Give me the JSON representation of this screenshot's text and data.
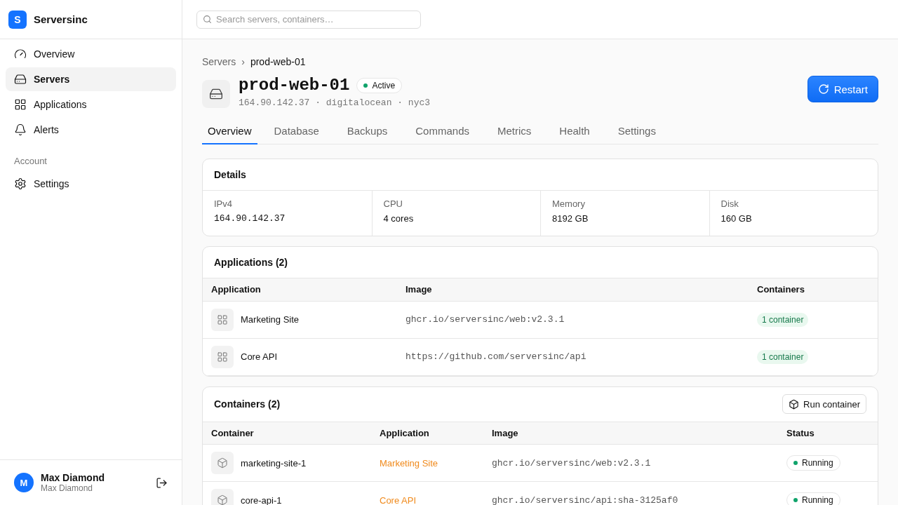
{
  "sidebar": {
    "logo_letter": "S",
    "brand": "Serversinc",
    "items": [
      {
        "label": "Overview",
        "selected": false
      },
      {
        "label": "Servers",
        "selected": true
      },
      {
        "label": "Applications",
        "selected": false
      },
      {
        "label": "Alerts",
        "selected": false
      }
    ],
    "section_label": "Account",
    "account_items": [
      {
        "label": "Settings",
        "selected": false
      }
    ],
    "user": {
      "initial": "M",
      "name": "Max Diamond",
      "subtitle": "Max Diamond"
    }
  },
  "search": {
    "placeholder": "Search servers, containers…"
  },
  "breadcrumb": {
    "parent": "Servers",
    "separator": "›",
    "current": "prod-web-01"
  },
  "server": {
    "name": "prod-web-01",
    "status": "Active",
    "meta": "164.90.142.37 · digitalocean · nyc3",
    "action": "Restart"
  },
  "tabs": [
    {
      "label": "Overview",
      "selected": true
    },
    {
      "label": "Database",
      "selected": false
    },
    {
      "label": "Backups",
      "selected": false
    },
    {
      "label": "Commands",
      "selected": false
    },
    {
      "label": "Metrics",
      "selected": false
    },
    {
      "label": "Health",
      "selected": false
    },
    {
      "label": "Settings",
      "selected": false
    }
  ],
  "details": {
    "title": "Details",
    "fields": [
      {
        "label": "IPv4",
        "value": "164.90.142.37",
        "kind": "code"
      },
      {
        "label": "CPU",
        "value": "4 cores",
        "kind": "text"
      },
      {
        "label": "Memory",
        "value": "8192 GB",
        "kind": "text"
      },
      {
        "label": "Disk",
        "value": "160 GB",
        "kind": "text"
      }
    ]
  },
  "applications": {
    "title": "Applications (2)",
    "columns": [
      "Application",
      "Image",
      "Containers"
    ],
    "rows": [
      {
        "name": "Marketing Site",
        "image": "ghcr.io/serversinc/web:v2.3.1",
        "containers": "1 container"
      },
      {
        "name": "Core API",
        "image": "https://github.com/serversinc/api",
        "containers": "1 container"
      }
    ]
  },
  "containers": {
    "title": "Containers (2)",
    "action": "Run container",
    "columns": [
      "Container",
      "Application",
      "Image",
      "Status"
    ],
    "rows": [
      {
        "name": "marketing-site-1",
        "application": "Marketing Site",
        "image": "ghcr.io/serversinc/web:v2.3.1",
        "status": "Running",
        "color": "#10a36b"
      },
      {
        "name": "core-api-1",
        "application": "Core API",
        "image": "ghcr.io/serversinc/api:sha-3125af0",
        "status": "Running",
        "color": "#10a36b"
      }
    ]
  }
}
